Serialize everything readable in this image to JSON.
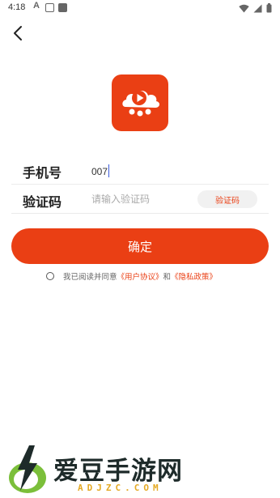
{
  "status_bar": {
    "time": "4:18"
  },
  "app": {
    "logo_icon": "video-play-cloud-icon",
    "brand_color": "#ea3f14"
  },
  "form": {
    "phone_label": "手机号",
    "phone_value": "007",
    "code_label": "验证码",
    "code_placeholder": "请输入验证码",
    "code_button": "验证码"
  },
  "confirm_label": "确定",
  "agreement": {
    "prefix": "我已阅读并同意",
    "user_agreement": "《用户协议》",
    "conjunction": "和",
    "privacy_policy": "《隐私政策》"
  },
  "watermark": {
    "text": "爱豆手游网",
    "domain": "ADJZC.COM"
  }
}
